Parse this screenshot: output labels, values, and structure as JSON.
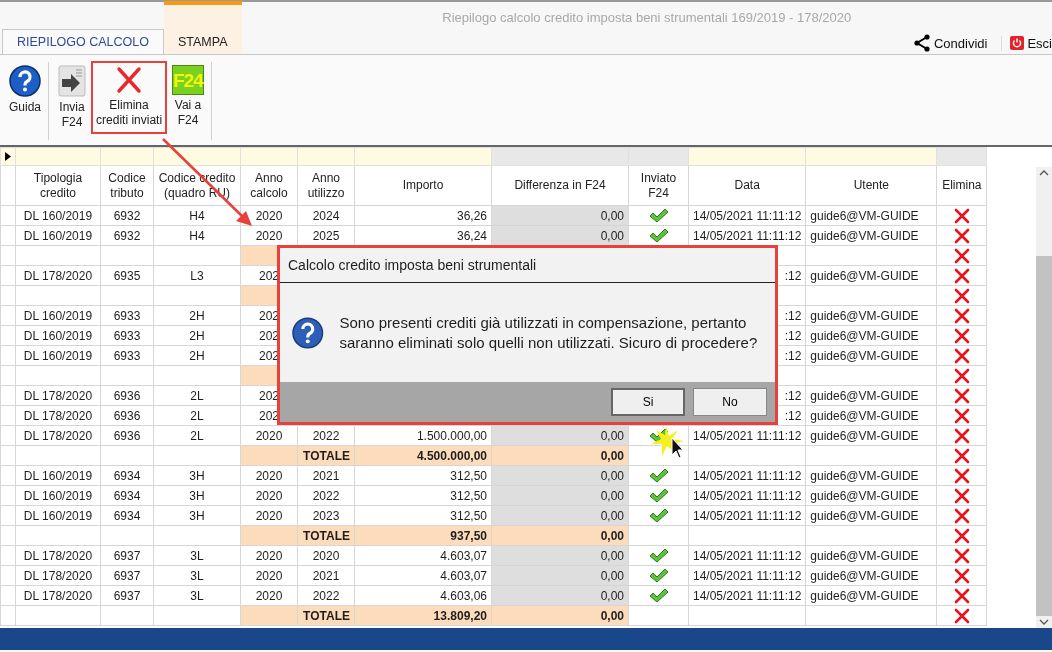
{
  "window": {
    "title": "Riepilogo calcolo credito imposta beni strumentali 169/2019 - 178/2020"
  },
  "tabs": [
    {
      "label": "RIEPILOGO CALCOLO",
      "selected": true,
      "highlighted": false
    },
    {
      "label": "STAMPA",
      "selected": false,
      "highlighted": true
    }
  ],
  "actions": [
    {
      "kind": "share",
      "label": "Condividi"
    },
    {
      "kind": "exit",
      "label": "Esci"
    }
  ],
  "ribbon": [
    {
      "kind": "help",
      "label": "Guida",
      "highlighted": false,
      "group_end": true
    },
    {
      "kind": "send",
      "label": "Invia\nF24",
      "highlighted": false,
      "group_end": false
    },
    {
      "kind": "delete",
      "label": "Elimina\ncrediti inviati",
      "highlighted": true,
      "group_end": false
    },
    {
      "kind": "f24",
      "label": "Vai a\nF24",
      "logo": "F24",
      "highlighted": false,
      "group_end": true
    }
  ],
  "table": {
    "columns": [
      "Tipologia\ncredito",
      "Codice\ntributo",
      "Codice credito\n(quadro RU)",
      "Anno\ncalcolo",
      "Anno\nutilizzo",
      "Importo",
      "Differenza in F24",
      "Inviato\nF24",
      "Data",
      "Utente",
      "Elimina"
    ],
    "rows": [
      {
        "kind": "entry",
        "cells": [
          "DL 160/2019",
          "6932",
          "H4",
          "2020",
          "2024",
          "36,26",
          "0,00"
        ],
        "inviato": true,
        "data": "14/05/2021 11:11:12",
        "utente": "guide6@VM-GUIDE"
      },
      {
        "kind": "entry",
        "cells": [
          "DL 160/2019",
          "6932",
          "H4",
          "2020",
          "2025",
          "36,24",
          "0,00"
        ],
        "inviato": true,
        "data": "14/05/2021 11:11:12",
        "utente": "guide6@VM-GUIDE"
      },
      {
        "kind": "total"
      },
      {
        "kind": "entry",
        "cells": [
          "DL 178/2020",
          "6935",
          "L3",
          "202"
        ],
        "data": ":12",
        "utente": "guide6@VM-GUIDE"
      },
      {
        "kind": "total"
      },
      {
        "kind": "entry",
        "cells": [
          "DL 160/2019",
          "6933",
          "2H",
          "202"
        ],
        "data": ":12",
        "utente": "guide6@VM-GUIDE"
      },
      {
        "kind": "entry",
        "cells": [
          "DL 160/2019",
          "6933",
          "2H",
          "202"
        ],
        "data": ":12",
        "utente": "guide6@VM-GUIDE"
      },
      {
        "kind": "entry",
        "cells": [
          "DL 160/2019",
          "6933",
          "2H",
          "202"
        ],
        "data": ":12",
        "utente": "guide6@VM-GUIDE"
      },
      {
        "kind": "total"
      },
      {
        "kind": "entry",
        "cells": [
          "DL 178/2020",
          "6936",
          "2L",
          "202"
        ],
        "data": ":12",
        "utente": "guide6@VM-GUIDE"
      },
      {
        "kind": "entry",
        "cells": [
          "DL 178/2020",
          "6936",
          "2L",
          "202"
        ],
        "data": ":12",
        "utente": "guide6@VM-GUIDE"
      },
      {
        "kind": "entry",
        "cells": [
          "DL 178/2020",
          "6936",
          "2L",
          "2020",
          "2022",
          "1.500.000,00",
          "0,00"
        ],
        "inviato": true,
        "data": "14/05/2021 11:11:12",
        "utente": "guide6@VM-GUIDE"
      },
      {
        "kind": "total",
        "label": "TOTALE",
        "importo": "4.500.000,00",
        "differenza": "0,00"
      },
      {
        "kind": "entry",
        "cells": [
          "DL 160/2019",
          "6934",
          "3H",
          "2020",
          "2021",
          "312,50",
          "0,00"
        ],
        "inviato": true,
        "data": "14/05/2021 11:11:12",
        "utente": "guide6@VM-GUIDE"
      },
      {
        "kind": "entry",
        "cells": [
          "DL 160/2019",
          "6934",
          "3H",
          "2020",
          "2022",
          "312,50",
          "0,00"
        ],
        "inviato": true,
        "data": "14/05/2021 11:11:12",
        "utente": "guide6@VM-GUIDE"
      },
      {
        "kind": "entry",
        "cells": [
          "DL 160/2019",
          "6934",
          "3H",
          "2020",
          "2023",
          "312,50",
          "0,00"
        ],
        "inviato": true,
        "data": "14/05/2021 11:11:12",
        "utente": "guide6@VM-GUIDE"
      },
      {
        "kind": "total",
        "label": "TOTALE",
        "importo": "937,50",
        "differenza": "0,00"
      },
      {
        "kind": "entry",
        "cells": [
          "DL 178/2020",
          "6937",
          "3L",
          "2020",
          "2020",
          "4.603,07",
          "0,00"
        ],
        "inviato": true,
        "data": "14/05/2021 11:11:12",
        "utente": "guide6@VM-GUIDE"
      },
      {
        "kind": "entry",
        "cells": [
          "DL 178/2020",
          "6937",
          "3L",
          "2020",
          "2021",
          "4.603,07",
          "0,00"
        ],
        "inviato": true,
        "data": "14/05/2021 11:11:12",
        "utente": "guide6@VM-GUIDE"
      },
      {
        "kind": "entry",
        "cells": [
          "DL 178/2020",
          "6937",
          "3L",
          "2020",
          "2022",
          "4.603,06",
          "0,00"
        ],
        "inviato": true,
        "data": "14/05/2021 11:11:12",
        "utente": "guide6@VM-GUIDE"
      },
      {
        "kind": "total",
        "label": "TOTALE",
        "importo": "13.809,20",
        "differenza": "0,00"
      }
    ]
  },
  "dialog": {
    "title": "Calcolo credito imposta beni strumentali",
    "message": "Sono presenti crediti già utilizzati in compensazione, pertanto saranno eliminati solo quelli non utilizzati. Sicuro di procedere?",
    "buttons": [
      {
        "label": "Si",
        "selected": true
      },
      {
        "label": "No",
        "selected": false
      }
    ]
  }
}
